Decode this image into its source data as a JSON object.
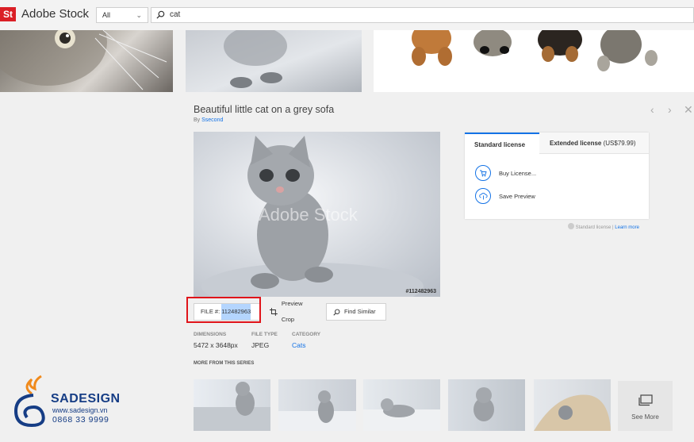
{
  "app": {
    "logo": "St",
    "brand": "Adobe Stock"
  },
  "search": {
    "filter": "All",
    "query": "cat"
  },
  "asset": {
    "title": "Beautiful little cat on a grey sofa",
    "by_prefix": "By",
    "author": "Ssecond",
    "watermark": "Adobe Stock",
    "file_number_overlay": "#112482963"
  },
  "license": {
    "tab_standard": "Standard license",
    "tab_extended": "Extended license",
    "extended_price": "(US$79.99)",
    "buy": "Buy License...",
    "save_preview": "Save Preview",
    "note": "Standard license |",
    "learn_more": "Learn more"
  },
  "actions": {
    "file_label": "FILE #:",
    "file_number": "112482963",
    "preview_crop": "Preview Crop",
    "find_similar": "Find Similar"
  },
  "meta": {
    "dimensions_label": "DIMENSIONS",
    "dimensions_value": "5472 x 3648px",
    "filetype_label": "FILE TYPE",
    "filetype_value": "JPEG",
    "category_label": "CATEGORY",
    "category_value": "Cats"
  },
  "series": {
    "label": "MORE FROM THIS SERIES",
    "see_more": "See More"
  },
  "sadesign": {
    "name": "SADESIGN",
    "website": "www.sadesign.vn",
    "phone": "0868 33 9999"
  },
  "colors": {
    "accent": "#1473e6",
    "logo_red": "#da1f26",
    "highlight_red": "#e0141a",
    "brand_navy": "#163d85"
  }
}
